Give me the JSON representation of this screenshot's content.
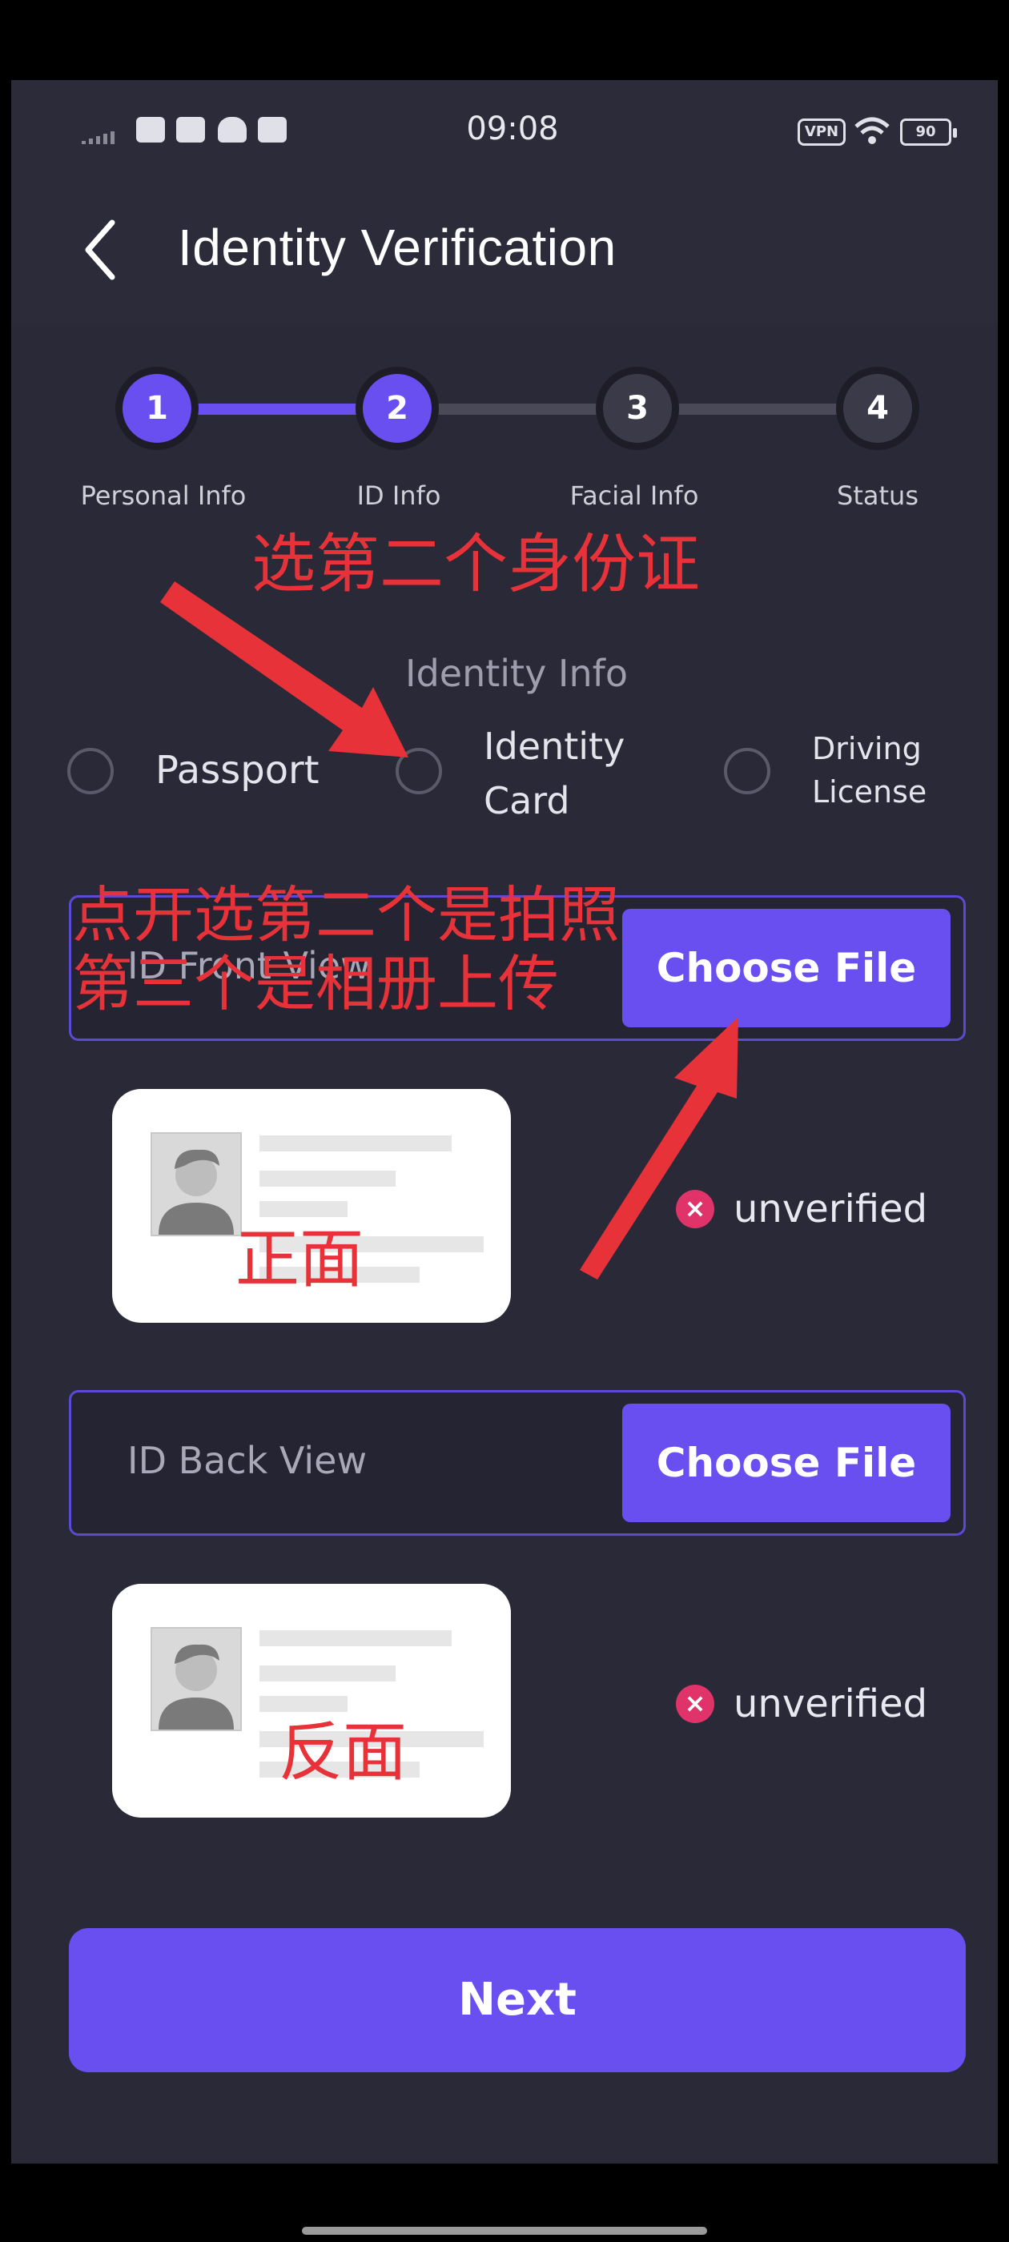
{
  "status_bar": {
    "time": "09:08",
    "vpn_label": "VPN",
    "battery_level": "90",
    "icons": [
      "signal-icon",
      "mail-icon",
      "message-icon",
      "notification-icon",
      "sim-icon",
      "vpn-icon",
      "wifi-icon",
      "battery-icon"
    ]
  },
  "header": {
    "back_icon": "chevron-left-icon",
    "title": "Identity Verification"
  },
  "stepper": {
    "current_step": 2,
    "steps": [
      {
        "number": "1",
        "label": "Personal Info"
      },
      {
        "number": "2",
        "label": "ID Info"
      },
      {
        "number": "3",
        "label": "Facial Info"
      },
      {
        "number": "4",
        "label": "Status"
      }
    ]
  },
  "section": {
    "title": "Identity Info"
  },
  "id_types": [
    {
      "label": "Passport",
      "selected": false
    },
    {
      "label_line1": "Identity",
      "label_line2": "Card",
      "selected": false
    },
    {
      "label_line1": "Driving",
      "label_line2": "License",
      "selected": false
    }
  ],
  "front": {
    "label": "ID Front View",
    "button": "Choose File",
    "status": "unverified"
  },
  "back": {
    "label": "ID Back View",
    "button": "Choose File",
    "status": "unverified"
  },
  "next_button": "Next",
  "annotations": {
    "select_second": "选第二个身份证",
    "open_line1": "点开选第二个是拍照",
    "open_line2": "第三个是相册上传",
    "front_side": "正面",
    "back_side": "反面"
  },
  "colors": {
    "accent": "#6a4ff0",
    "background": "#2a2937",
    "error": "#e0336a",
    "annotation": "#e8323a"
  }
}
